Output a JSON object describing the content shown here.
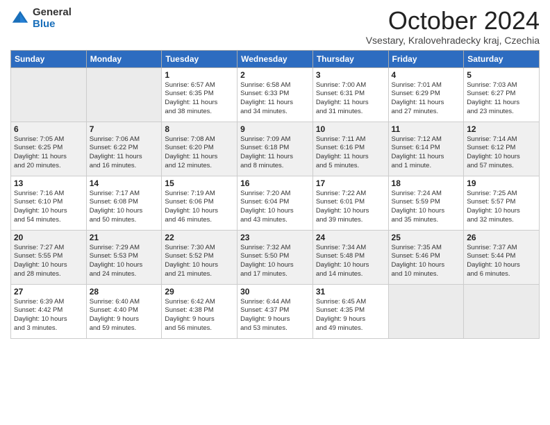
{
  "logo": {
    "general": "General",
    "blue": "Blue"
  },
  "header": {
    "month": "October 2024",
    "location": "Vsestary, Kralovehradecky kraj, Czechia"
  },
  "weekdays": [
    "Sunday",
    "Monday",
    "Tuesday",
    "Wednesday",
    "Thursday",
    "Friday",
    "Saturday"
  ],
  "weeks": [
    [
      {
        "day": "",
        "info": ""
      },
      {
        "day": "",
        "info": ""
      },
      {
        "day": "1",
        "info": "Sunrise: 6:57 AM\nSunset: 6:35 PM\nDaylight: 11 hours\nand 38 minutes."
      },
      {
        "day": "2",
        "info": "Sunrise: 6:58 AM\nSunset: 6:33 PM\nDaylight: 11 hours\nand 34 minutes."
      },
      {
        "day": "3",
        "info": "Sunrise: 7:00 AM\nSunset: 6:31 PM\nDaylight: 11 hours\nand 31 minutes."
      },
      {
        "day": "4",
        "info": "Sunrise: 7:01 AM\nSunset: 6:29 PM\nDaylight: 11 hours\nand 27 minutes."
      },
      {
        "day": "5",
        "info": "Sunrise: 7:03 AM\nSunset: 6:27 PM\nDaylight: 11 hours\nand 23 minutes."
      }
    ],
    [
      {
        "day": "6",
        "info": "Sunrise: 7:05 AM\nSunset: 6:25 PM\nDaylight: 11 hours\nand 20 minutes."
      },
      {
        "day": "7",
        "info": "Sunrise: 7:06 AM\nSunset: 6:22 PM\nDaylight: 11 hours\nand 16 minutes."
      },
      {
        "day": "8",
        "info": "Sunrise: 7:08 AM\nSunset: 6:20 PM\nDaylight: 11 hours\nand 12 minutes."
      },
      {
        "day": "9",
        "info": "Sunrise: 7:09 AM\nSunset: 6:18 PM\nDaylight: 11 hours\nand 8 minutes."
      },
      {
        "day": "10",
        "info": "Sunrise: 7:11 AM\nSunset: 6:16 PM\nDaylight: 11 hours\nand 5 minutes."
      },
      {
        "day": "11",
        "info": "Sunrise: 7:12 AM\nSunset: 6:14 PM\nDaylight: 11 hours\nand 1 minute."
      },
      {
        "day": "12",
        "info": "Sunrise: 7:14 AM\nSunset: 6:12 PM\nDaylight: 10 hours\nand 57 minutes."
      }
    ],
    [
      {
        "day": "13",
        "info": "Sunrise: 7:16 AM\nSunset: 6:10 PM\nDaylight: 10 hours\nand 54 minutes."
      },
      {
        "day": "14",
        "info": "Sunrise: 7:17 AM\nSunset: 6:08 PM\nDaylight: 10 hours\nand 50 minutes."
      },
      {
        "day": "15",
        "info": "Sunrise: 7:19 AM\nSunset: 6:06 PM\nDaylight: 10 hours\nand 46 minutes."
      },
      {
        "day": "16",
        "info": "Sunrise: 7:20 AM\nSunset: 6:04 PM\nDaylight: 10 hours\nand 43 minutes."
      },
      {
        "day": "17",
        "info": "Sunrise: 7:22 AM\nSunset: 6:01 PM\nDaylight: 10 hours\nand 39 minutes."
      },
      {
        "day": "18",
        "info": "Sunrise: 7:24 AM\nSunset: 5:59 PM\nDaylight: 10 hours\nand 35 minutes."
      },
      {
        "day": "19",
        "info": "Sunrise: 7:25 AM\nSunset: 5:57 PM\nDaylight: 10 hours\nand 32 minutes."
      }
    ],
    [
      {
        "day": "20",
        "info": "Sunrise: 7:27 AM\nSunset: 5:55 PM\nDaylight: 10 hours\nand 28 minutes."
      },
      {
        "day": "21",
        "info": "Sunrise: 7:29 AM\nSunset: 5:53 PM\nDaylight: 10 hours\nand 24 minutes."
      },
      {
        "day": "22",
        "info": "Sunrise: 7:30 AM\nSunset: 5:52 PM\nDaylight: 10 hours\nand 21 minutes."
      },
      {
        "day": "23",
        "info": "Sunrise: 7:32 AM\nSunset: 5:50 PM\nDaylight: 10 hours\nand 17 minutes."
      },
      {
        "day": "24",
        "info": "Sunrise: 7:34 AM\nSunset: 5:48 PM\nDaylight: 10 hours\nand 14 minutes."
      },
      {
        "day": "25",
        "info": "Sunrise: 7:35 AM\nSunset: 5:46 PM\nDaylight: 10 hours\nand 10 minutes."
      },
      {
        "day": "26",
        "info": "Sunrise: 7:37 AM\nSunset: 5:44 PM\nDaylight: 10 hours\nand 6 minutes."
      }
    ],
    [
      {
        "day": "27",
        "info": "Sunrise: 6:39 AM\nSunset: 4:42 PM\nDaylight: 10 hours\nand 3 minutes."
      },
      {
        "day": "28",
        "info": "Sunrise: 6:40 AM\nSunset: 4:40 PM\nDaylight: 9 hours\nand 59 minutes."
      },
      {
        "day": "29",
        "info": "Sunrise: 6:42 AM\nSunset: 4:38 PM\nDaylight: 9 hours\nand 56 minutes."
      },
      {
        "day": "30",
        "info": "Sunrise: 6:44 AM\nSunset: 4:37 PM\nDaylight: 9 hours\nand 53 minutes."
      },
      {
        "day": "31",
        "info": "Sunrise: 6:45 AM\nSunset: 4:35 PM\nDaylight: 9 hours\nand 49 minutes."
      },
      {
        "day": "",
        "info": ""
      },
      {
        "day": "",
        "info": ""
      }
    ]
  ],
  "row_shading": [
    false,
    true,
    false,
    true,
    false
  ]
}
